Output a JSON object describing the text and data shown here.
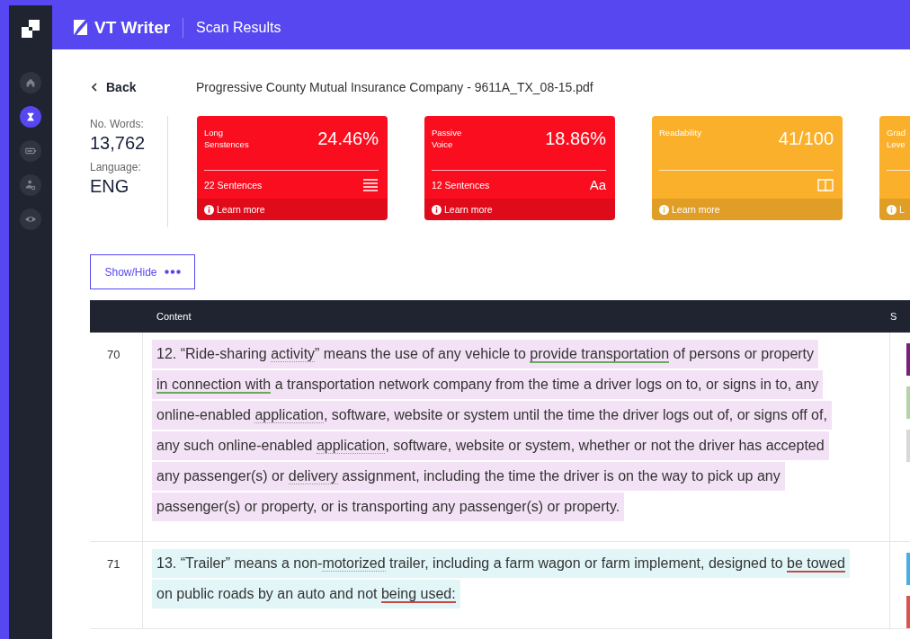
{
  "header": {
    "brand": "VT Writer",
    "title": "Scan Results"
  },
  "sidebar": {
    "items": [
      {
        "selected": false
      },
      {
        "selected": true
      },
      {
        "selected": false
      },
      {
        "selected": false
      },
      {
        "selected": false
      }
    ]
  },
  "back": "Back",
  "document": "Progressive County Mutual Insurance Company - 9611A_TX_08-15.pdf",
  "stats": [
    {
      "label": "No. Words:",
      "value": "13,762"
    },
    {
      "label": "Language:",
      "value": "ENG"
    }
  ],
  "cards": [
    {
      "title": [
        "Long",
        "Senstences"
      ],
      "value": "24.46%",
      "detail": "22 Sentences",
      "color": "#fa0d1e",
      "link": "Learn more"
    },
    {
      "title": [
        "Passive",
        "Voice"
      ],
      "value": "18.86%",
      "detail": "12 Sentences",
      "icon_text": "Aa",
      "color": "#fa0d1e",
      "link": "Learn more"
    },
    {
      "title": [
        "Readability"
      ],
      "value": "41/100",
      "color": "#fbb02c",
      "link": "Learn more"
    },
    {
      "title": [
        "Grad",
        "Leve"
      ],
      "color": "#fbb02c",
      "link": "L"
    }
  ],
  "show_hide": "Show/Hide",
  "table": {
    "columns": [
      "Content",
      "S"
    ],
    "rows": [
      {
        "number": "70",
        "color": "#f3e2f5",
        "tags": [
          {
            "color": "#7a1f7a"
          },
          {
            "color": "#b5d3a8"
          },
          {
            "color": "#d8d8d8"
          }
        ],
        "lines": [
          [
            {
              "text": "12.  “Ride-sharing "
            },
            {
              "text": "activity",
              "kind": "dotted"
            },
            {
              "text": "” means the use of any vehicle to "
            },
            {
              "text": "provide transportation",
              "kind": "positive"
            },
            {
              "text": " of persons or property"
            }
          ],
          [
            {
              "text": "in connection with",
              "kind": "positive"
            },
            {
              "text": " a transportation network company from the time a driver logs on to, or signs in to, any"
            }
          ],
          [
            {
              "text": "online-enabled "
            },
            {
              "text": "application",
              "kind": "dotted"
            },
            {
              "text": ", software, website or system until the time the driver logs out of, or signs off of,"
            }
          ],
          [
            {
              "text": "any such online-enabled "
            },
            {
              "text": "application",
              "kind": "dotted"
            },
            {
              "text": ", software, website or system, whether or not the driver has accepted"
            }
          ],
          [
            {
              "text": "any passenger(s) or "
            },
            {
              "text": "delivery",
              "kind": "dotted"
            },
            {
              "text": " assignment, including the time the driver is on the way to pick up any"
            }
          ],
          [
            {
              "text": "passenger(s) or property, or is transporting any passenger(s) or property. "
            }
          ]
        ]
      },
      {
        "number": "71",
        "color": "#e2f6f8",
        "tags": [
          {
            "color": "#4aaee0"
          },
          {
            "color": "#d9544f"
          }
        ],
        "lines": [
          [
            {
              "text": "13.  “Trailer” means a non-"
            },
            {
              "text": "motorized",
              "kind": "dotted"
            },
            {
              "text": " trailer, including a farm wagon or farm implement, designed to "
            },
            {
              "text": "be towed",
              "kind": "negative"
            }
          ],
          [
            {
              "text": "on public roads by an auto and not "
            },
            {
              "text": "being used:",
              "kind": "negative"
            }
          ]
        ]
      }
    ]
  }
}
